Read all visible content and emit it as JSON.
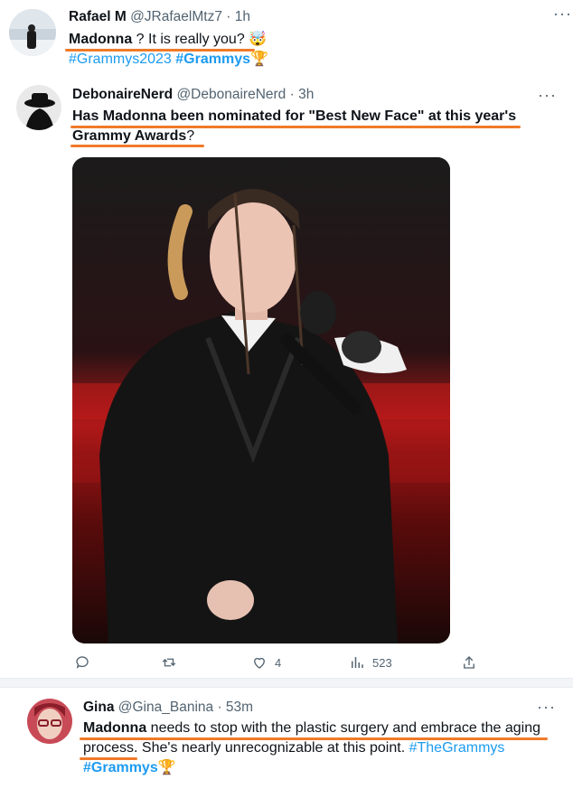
{
  "tweets": [
    {
      "name": "Rafael M",
      "handle": "@JRafaelMtz7",
      "time": "· 1h",
      "line1_bold": "Madonna",
      "line1_rest": " ? It is really you? 🤯",
      "hashtag1": "#Grammys2023",
      "hashtag2": "#Grammys",
      "hashtag2_emoji": "🏆"
    },
    {
      "name": "DebonaireNerd",
      "handle": "@DebonaireNerd",
      "time": "· 3h",
      "line1_bold": "Has Madonna been nominated for \"Best New Face\" at this year's",
      "line2_bold": "Grammy Awards",
      "line2_rest": "?",
      "stats": {
        "replies": "",
        "retweets": "",
        "likes": "4",
        "views": "523"
      }
    },
    {
      "name": "Gina",
      "handle": "@Gina_Banina",
      "time": "· 53m",
      "line1_bold": "Madonna",
      "line1_rest": " needs to stop with the plastic surgery and embrace the aging",
      "line2_a": "process.",
      "line2_b": " She's nearly unrecognizable at this point. ",
      "line2_tag": "#TheGrammys",
      "hashtag": "#Grammys",
      "hashtag_emoji": "🏆"
    }
  ],
  "icons": [
    "reply-icon",
    "retweet-icon",
    "like-icon",
    "views-icon",
    "share-icon",
    "more-icon"
  ],
  "colors": {
    "accent": "#1d9bf0",
    "underline": "#f07a2a",
    "muted": "#536471"
  }
}
